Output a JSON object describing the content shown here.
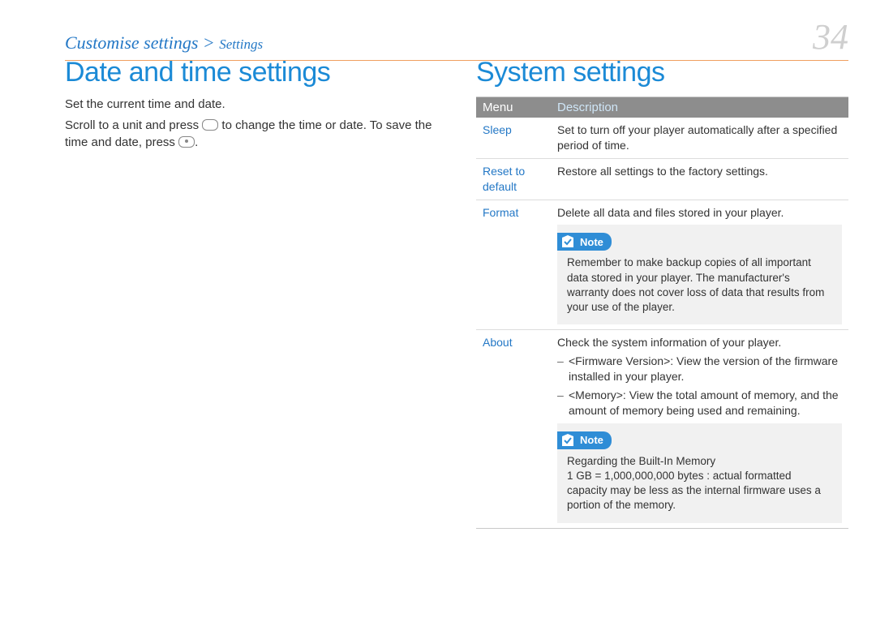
{
  "header": {
    "breadcrumb_main": "Customise settings",
    "breadcrumb_sep": " > ",
    "breadcrumb_sub": "Settings",
    "page_number": "34"
  },
  "left": {
    "title": "Date and time settings",
    "p1": "Set the current time and date.",
    "p2a": "Scroll to a unit and press ",
    "p2b": " to change the time or date. To save the time and date, press ",
    "p2c": "."
  },
  "right": {
    "title": "System settings",
    "table": {
      "head_menu": "Menu",
      "head_desc": "Description",
      "rows": {
        "sleep": {
          "menu": "Sleep",
          "desc": "Set to turn off your player automatically after a specified period of time."
        },
        "reset": {
          "menu": "Reset to default",
          "desc": "Restore all settings to the factory settings."
        },
        "format": {
          "menu": "Format",
          "desc_intro": "Delete all data and files stored in your player.",
          "note_label": "Note",
          "note_text": "Remember to make backup copies of all important data stored in your player. The manufacturer's warranty does not cover loss of data that results from your use of the player."
        },
        "about": {
          "menu": "About",
          "desc_intro": "Check the system information of your player.",
          "bullet1": "<Firmware Version>: View the version of the firmware installed in your player.",
          "bullet2": "<Memory>: View the total amount of memory, and the amount of memory being used and remaining.",
          "note_label": "Note",
          "note_heading": "Regarding the Built-In Memory",
          "note_text": "1 GB = 1,000,000,000 bytes : actual formatted capacity may be less as the internal firmware uses a portion of the memory."
        }
      }
    }
  }
}
